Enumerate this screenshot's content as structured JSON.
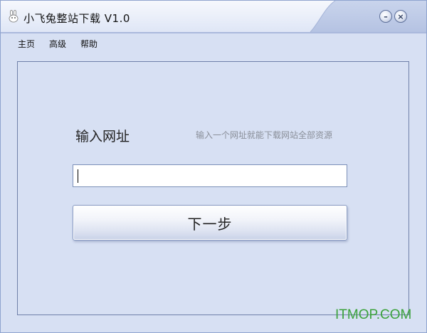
{
  "window": {
    "title": "小飞兔整站下载 V1.0",
    "minimize_glyph": "–",
    "close_glyph": "×"
  },
  "menu": {
    "items": [
      "主页",
      "高级",
      "帮助"
    ]
  },
  "main": {
    "url_label": "输入网址",
    "url_hint": "输入一个网址就能下载网站全部资源",
    "url_value": "",
    "next_button_label": "下一步"
  },
  "watermark": "ITMOP.COM",
  "colors": {
    "window_bg": "#d7e0f3",
    "titlebar_light": "#f4f7fd",
    "titlebar_dark": "#c3cfe9",
    "watermark": "#3ba23b"
  }
}
